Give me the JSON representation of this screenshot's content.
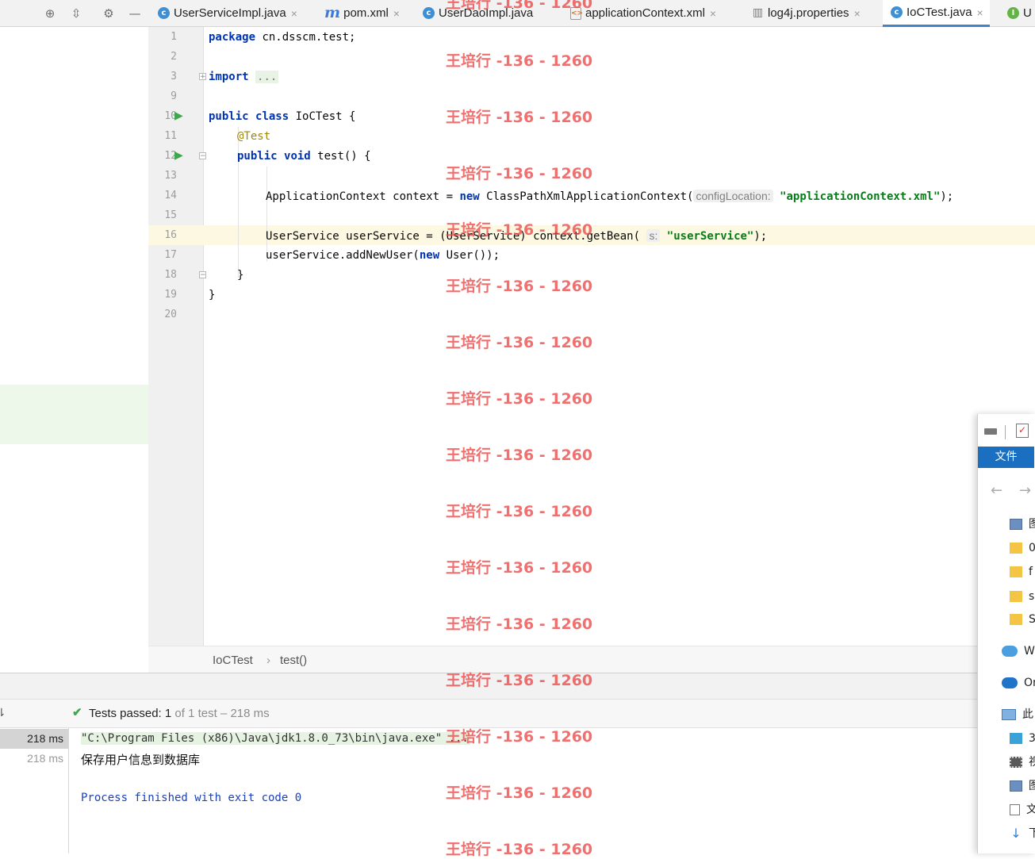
{
  "tabs": [
    {
      "label": "UserServiceImpl.java",
      "icon": "java-class-icon",
      "active": false
    },
    {
      "label": "pom.xml",
      "icon": "maven-icon",
      "active": false
    },
    {
      "label": "UserDaoImpl.java",
      "icon": "java-class-icon",
      "active": false
    },
    {
      "label": "applicationContext.xml",
      "icon": "xml-file-icon",
      "active": false
    },
    {
      "label": "log4j.properties",
      "icon": "properties-file-icon",
      "active": false
    },
    {
      "label": "IoCTest.java",
      "icon": "java-test-class-icon",
      "active": true
    },
    {
      "label": "U",
      "icon": "java-interface-icon",
      "active": false
    }
  ],
  "editor": {
    "current_line": 16,
    "lines": [
      {
        "n": "1",
        "text": "package cn.dsscm.test;"
      },
      {
        "n": "2",
        "text": ""
      },
      {
        "n": "3",
        "text": "import ..."
      },
      {
        "n": "9",
        "text": ""
      },
      {
        "n": "10",
        "text": "public class IoCTest {"
      },
      {
        "n": "11",
        "text": "@Test"
      },
      {
        "n": "12",
        "text": "public void test() {"
      },
      {
        "n": "13",
        "text": ""
      },
      {
        "n": "14",
        "text": "ApplicationContext context = new ClassPathXmlApplicationContext( configLocation: \"applicationContext.xml\");"
      },
      {
        "n": "15",
        "text": ""
      },
      {
        "n": "16",
        "text": "UserService userService = (UserService) context.getBean( s: \"userService\");"
      },
      {
        "n": "17",
        "text": "userService.addNewUser(new User());"
      },
      {
        "n": "18",
        "text": "}"
      },
      {
        "n": "19",
        "text": "}"
      },
      {
        "n": "20",
        "text": ""
      }
    ],
    "tokens": {
      "kw_package": "package",
      "pkg": " cn.dsscm.test;",
      "kw_import": "import",
      "folded": "...",
      "kw_public": "public",
      "kw_class": "class",
      "cls": " IoCTest {",
      "anno": "@Test",
      "kw_void": "void",
      "method": " test() {",
      "l14a": "ApplicationContext context = ",
      "kw_new": "new",
      "l14b": " ClassPathXmlApplicationContext(",
      "hint_config": "configLocation:",
      "str_appctx": "\"applicationContext.xml\"",
      "l14c": ");",
      "l16a": "UserService userService = (UserService) context.getBean(",
      "hint_s": "s:",
      "str_usersvc": "\"userService\"",
      "l16b": ");",
      "l17a": "userService.addNewUser(",
      "l17b": " User());",
      "brace_close": "}"
    }
  },
  "breadcrumbs": [
    "IoCTest",
    "test()"
  ],
  "run": {
    "status_prefix": "Tests passed:",
    "passed": "1",
    "status_suffix": "of 1 test – 218 ms",
    "tree": [
      {
        "time": "218 ms",
        "selected": true
      },
      {
        "time": "218 ms",
        "selected": false
      }
    ],
    "console": [
      "\"C:\\Program Files (x86)\\Java\\jdk1.8.0_73\\bin\\java.exe\" ...",
      "保存用户信息到数据库",
      "",
      "Process finished with exit code 0"
    ]
  },
  "watermark": "王培行 -136 - 1260",
  "explorer": {
    "ribbon_tab": "文件",
    "items": [
      {
        "label": "图",
        "icon": "picture-folder-icon"
      },
      {
        "label": "0",
        "icon": "folder-icon"
      },
      {
        "label": "f",
        "icon": "folder-icon"
      },
      {
        "label": "s",
        "icon": "folder-icon"
      },
      {
        "label": "S",
        "icon": "folder-icon"
      },
      {
        "label": "WI",
        "icon": "onedrive-icon"
      },
      {
        "label": "On",
        "icon": "onedrive-icon"
      },
      {
        "label": "此",
        "icon": "this-pc-icon"
      },
      {
        "label": "3",
        "icon": "3d-objects-icon"
      },
      {
        "label": "视",
        "icon": "video-icon"
      },
      {
        "label": "图",
        "icon": "picture-folder-icon"
      },
      {
        "label": "文",
        "icon": "document-icon"
      },
      {
        "label": "下",
        "icon": "download-icon"
      }
    ]
  },
  "colors": {
    "keyword": "#0033b3",
    "string": "#067d17",
    "annotation": "#9e880d",
    "accent": "#4083c9",
    "watermark": "#ec4848"
  }
}
